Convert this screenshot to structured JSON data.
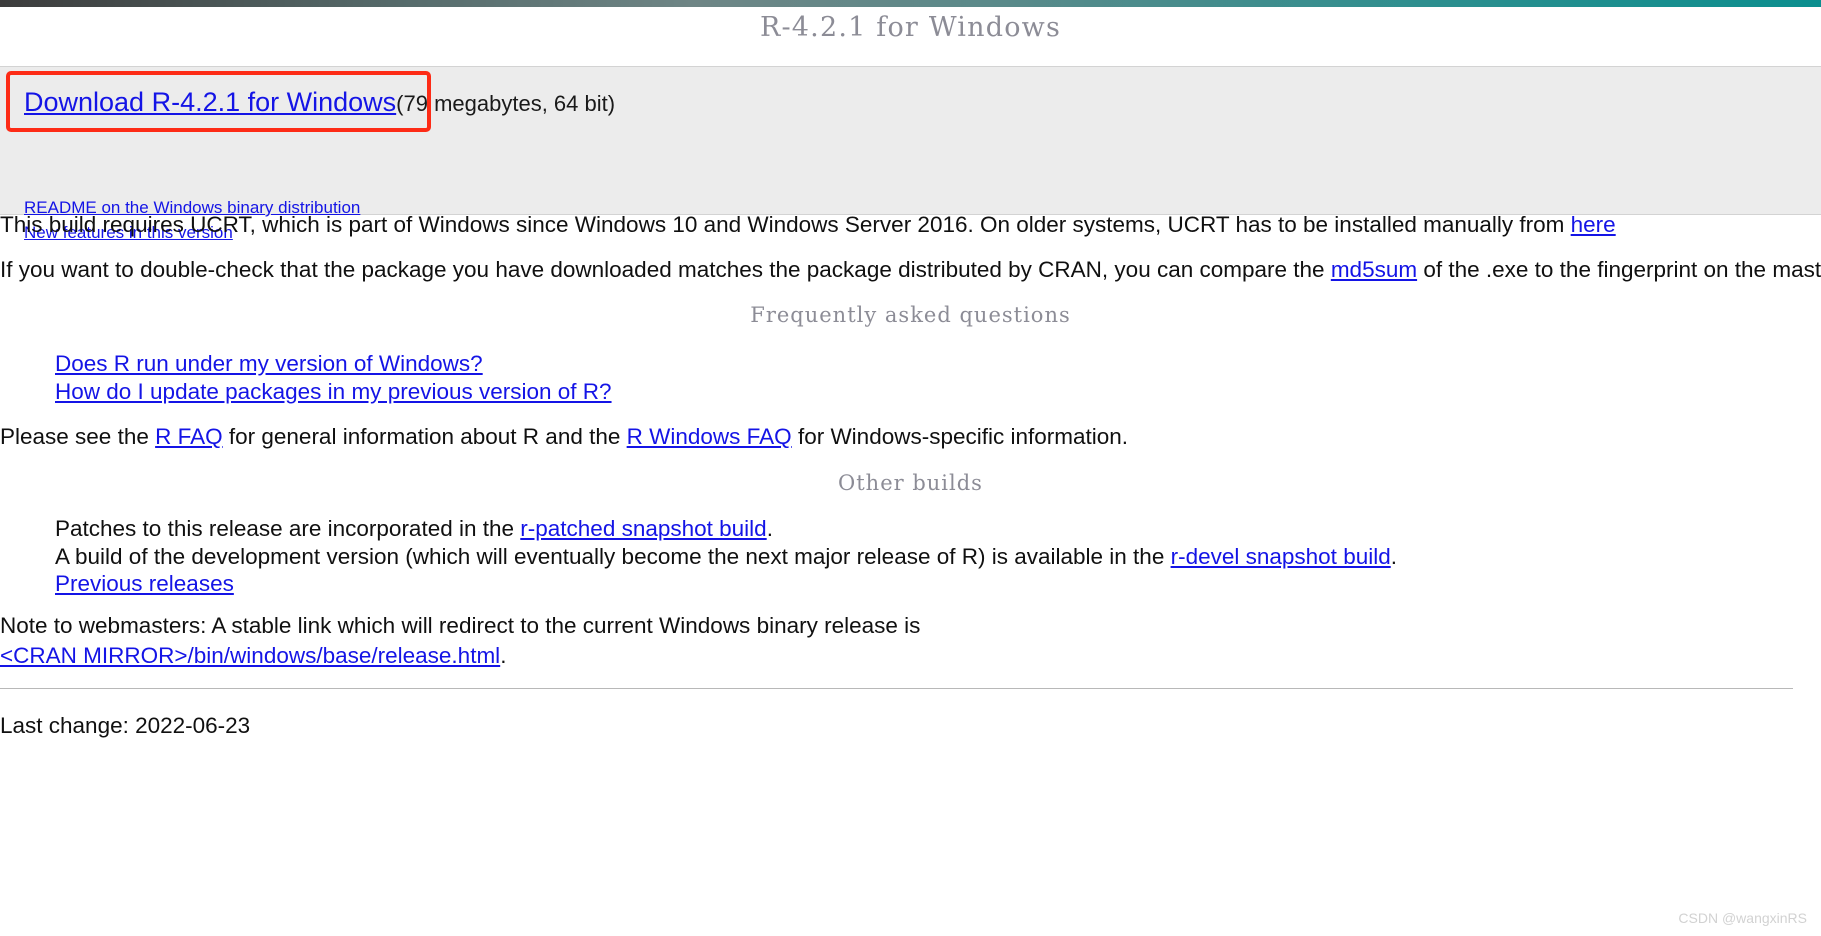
{
  "page": {
    "title": "R-4.2.1 for Windows",
    "accent_top_bar_from": "#3c3c3c",
    "accent_top_bar_to": "#0b8f8f",
    "link_color": "#1414e6",
    "highlight_box_color": "#fd2b16",
    "panel_background": "#ececec"
  },
  "download_panel": {
    "download_link": "Download R-4.2.1 for Windows",
    "download_meta": "(79 megabytes, 64 bit)",
    "readme_link": "README on the Windows binary distribution",
    "new_features_link": "New features in this version"
  },
  "paragraphs": {
    "ucrt_part1": "This build requires UCRT, which is part of Windows since Windows 10 and Windows Server 2016. On older systems, UCRT has to be installed manually from ",
    "ucrt_link": "here",
    "md5_part1": "If you want to double-check that the package you have downloaded matches the package distributed by CRAN, you can compare the ",
    "md5_link": "md5sum",
    "md5_part2": " of the .exe to the fingerprint on the master server.",
    "faq_part1": "Please see the ",
    "faq_link1": "R FAQ",
    "faq_part2": " for general information about R and the ",
    "faq_link2": "R Windows FAQ",
    "faq_part3": " for Windows-specific information.",
    "webmaster_note": "Note to webmasters: A stable link which will redirect to the current Windows binary release is",
    "webmaster_link": "<CRAN MIRROR>/bin/windows/base/release.html",
    "webmaster_period": ".",
    "last_change": "Last change: 2022-06-23"
  },
  "faq_section": {
    "heading": "Frequently asked questions",
    "items": [
      {
        "link": "Does R run under my version of Windows?"
      },
      {
        "link": "How do I update packages in my previous version of R?"
      }
    ]
  },
  "other_builds_section": {
    "heading": "Other builds",
    "items": [
      {
        "pre": "Patches to this release are incorporated in the ",
        "link": "r-patched snapshot build",
        "post": "."
      },
      {
        "pre": "A build of the development version (which will eventually become the next major release of R) is available in the ",
        "link": "r-devel snapshot build",
        "post": "."
      },
      {
        "pre": "",
        "link": "Previous releases",
        "post": ""
      }
    ]
  },
  "watermark": {
    "text": "CSDN @wangxinRS"
  }
}
